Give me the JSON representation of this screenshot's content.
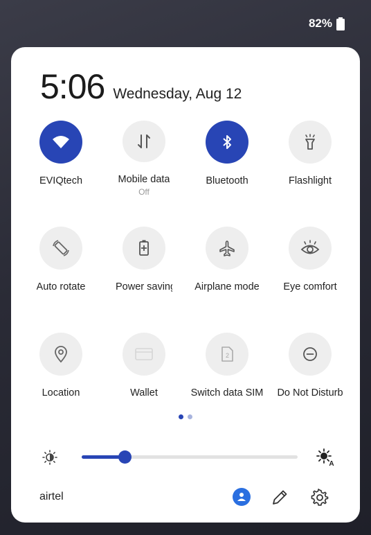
{
  "status_bar": {
    "battery_percent": "82%",
    "battery_icon": "battery-full-icon"
  },
  "header": {
    "time": "5:06",
    "date": "Wednesday, Aug 12"
  },
  "tiles": [
    {
      "label": "EVIQtech",
      "icon": "wifi-icon",
      "active": true
    },
    {
      "label": "Mobile data",
      "sublabel": "Off",
      "icon": "mobile-data-icon",
      "active": false
    },
    {
      "label": "Bluetooth",
      "icon": "bluetooth-icon",
      "active": true
    },
    {
      "label": "Flashlight",
      "icon": "flashlight-icon",
      "active": false
    },
    {
      "label": "Auto rotate",
      "icon": "auto-rotate-icon",
      "active": false
    },
    {
      "label": "Power saving",
      "icon": "battery-saver-icon",
      "active": false
    },
    {
      "label": "Airplane mode",
      "icon": "airplane-icon",
      "active": false
    },
    {
      "label": "Eye comfort",
      "icon": "eye-icon",
      "active": false
    },
    {
      "label": "Location",
      "icon": "location-icon",
      "active": false
    },
    {
      "label": "Wallet",
      "icon": "wallet-icon",
      "active": false
    },
    {
      "label": "Switch data SIM",
      "icon": "sim-card-icon",
      "active": false
    },
    {
      "label": "Do Not Disturb",
      "icon": "do-not-disturb-icon",
      "active": false
    }
  ],
  "pager": {
    "pages": 2,
    "current": 1
  },
  "brightness": {
    "level_fraction": 0.2
  },
  "footer": {
    "carrier": "airtel",
    "icons": [
      "user-icon",
      "edit-pencil-icon",
      "settings-gear-icon"
    ]
  },
  "colors": {
    "accent": "#2845b5",
    "inactive_tile": "#eeeeee",
    "user_badge": "#2a6fe0"
  }
}
